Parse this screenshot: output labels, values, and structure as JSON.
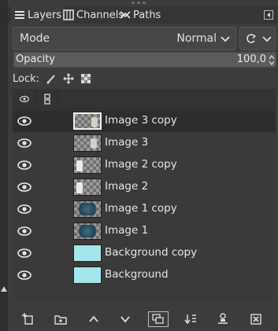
{
  "tabs": [
    {
      "label": "Layers",
      "icon": "layers-icon",
      "active": true
    },
    {
      "label": "Channels",
      "icon": "channels-icon",
      "active": false
    },
    {
      "label": "Paths",
      "icon": "paths-icon",
      "active": false
    }
  ],
  "mode": {
    "label": "Mode",
    "value": "Normal"
  },
  "opacity": {
    "label": "Opacity",
    "value": "100,0"
  },
  "lock": {
    "label": "Lock:",
    "icons": [
      "brush-lock-icon",
      "move-lock-icon",
      "alpha-lock-icon"
    ]
  },
  "columns": [
    "visibility-eye-icon",
    "chain-link-icon"
  ],
  "layers": [
    {
      "name": "Image 3 copy",
      "thumb": "checker",
      "selected": true,
      "visible": true
    },
    {
      "name": "Image 3",
      "thumb": "checker",
      "selected": false,
      "visible": true
    },
    {
      "name": "Image 2 copy",
      "thumb": "checker",
      "selected": false,
      "visible": true
    },
    {
      "name": "Image 2",
      "thumb": "checker",
      "selected": false,
      "visible": true
    },
    {
      "name": "Image 1 copy",
      "thumb": "checker",
      "selected": false,
      "visible": true
    },
    {
      "name": "Image 1",
      "thumb": "checker",
      "selected": false,
      "visible": true
    },
    {
      "name": "Background copy",
      "thumb": "cyan",
      "selected": false,
      "visible": true
    },
    {
      "name": "Background",
      "thumb": "cyan",
      "selected": false,
      "visible": true
    }
  ],
  "bottom_buttons": [
    "new-layer-icon",
    "new-group-icon",
    "raise-layer-icon",
    "lower-layer-icon",
    "duplicate-layer-icon",
    "merge-down-icon",
    "anchor-mask-icon",
    "delete-layer-icon"
  ],
  "colors": {
    "panel_bg": "#3c3c3c",
    "selected_row": "#2d2d2d",
    "background_thumb": "#a5e6ea"
  }
}
